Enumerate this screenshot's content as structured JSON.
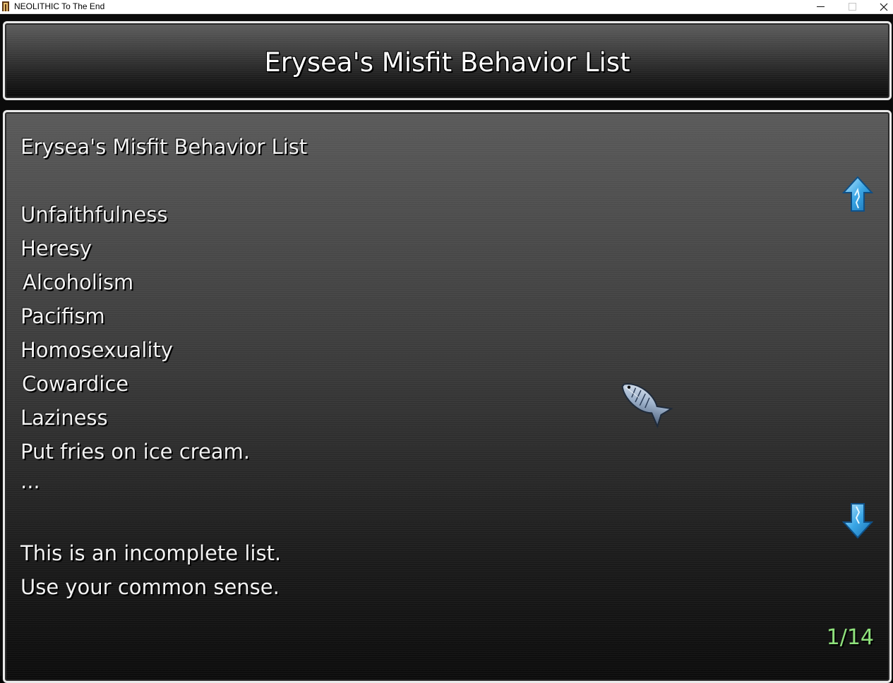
{
  "window": {
    "title": "NEOLITHIC To The End",
    "min_label": "—",
    "max_label": "☐",
    "close_label": "✕"
  },
  "header": {
    "title": "Erysea's Misfit Behavior List"
  },
  "content": {
    "heading": "Erysea's Misfit Behavior List",
    "items": [
      "Unfaithfulness",
      "Heresy",
      "Alcoholism",
      "Pacifism",
      "Homosexuality",
      "Cowardice",
      "Laziness",
      "Put fries on ice cream.",
      "..."
    ],
    "note_line_1": "This is an incomplete list.",
    "note_line_2": "Use your common sense."
  },
  "pagination": {
    "counter": "1/14",
    "current": 1,
    "total": 14
  },
  "icons": {
    "scroll_up": "arrow-up-icon",
    "scroll_down": "arrow-down-icon",
    "cursor": "fish-cursor-icon"
  },
  "colors": {
    "text": "#f2f2f2",
    "page_counter": "#8fe27c",
    "arrow": "#3aa6e6",
    "panel_border": "#eaeaea"
  }
}
